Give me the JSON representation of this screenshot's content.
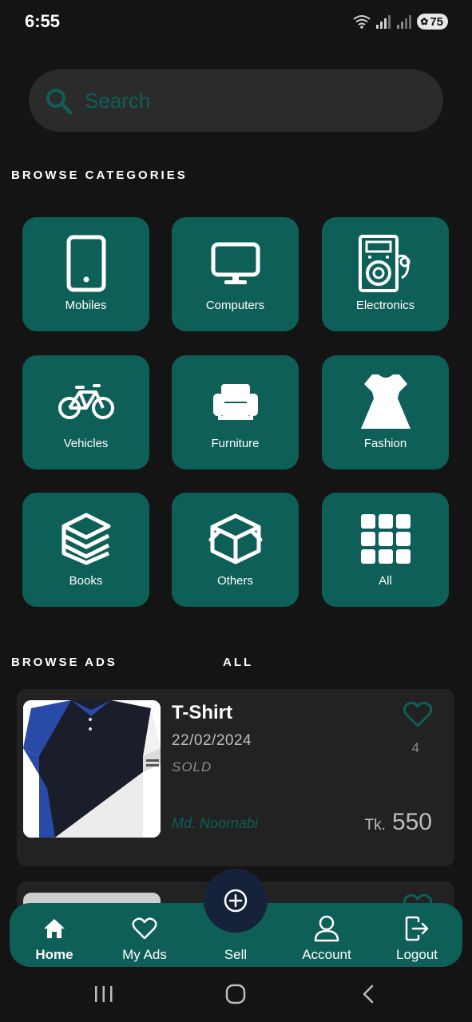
{
  "status_bar": {
    "time": "6:55",
    "battery": "75"
  },
  "search": {
    "placeholder": "Search"
  },
  "categories": {
    "title": "BROWSE CATEGORIES",
    "items": [
      {
        "label": "Mobiles",
        "icon": "mobile-icon"
      },
      {
        "label": "Computers",
        "icon": "monitor-icon"
      },
      {
        "label": "Electronics",
        "icon": "speaker-icon"
      },
      {
        "label": "Vehicles",
        "icon": "bicycle-icon"
      },
      {
        "label": "Furniture",
        "icon": "armchair-icon"
      },
      {
        "label": "Fashion",
        "icon": "dress-icon"
      },
      {
        "label": "Books",
        "icon": "books-icon"
      },
      {
        "label": "Others",
        "icon": "box-icon"
      },
      {
        "label": "All",
        "icon": "grid-icon"
      }
    ]
  },
  "ads": {
    "title": "BROWSE ADS",
    "filter": "ALL",
    "items": [
      {
        "title": "T-Shirt",
        "date": "22/02/2024",
        "status": "SOLD",
        "seller": "Md. Noornabi",
        "currency": "Tk.",
        "price": "550",
        "likes": "4"
      }
    ]
  },
  "bottom_nav": {
    "items": [
      {
        "label": "Home",
        "icon": "home-icon"
      },
      {
        "label": "My Ads",
        "icon": "heart-icon"
      },
      {
        "label": "Sell",
        "icon": "plus-circle-icon"
      },
      {
        "label": "Account",
        "icon": "user-icon"
      },
      {
        "label": "Logout",
        "icon": "logout-icon"
      }
    ]
  },
  "colors": {
    "background": "#141414",
    "accent": "#0e5f57",
    "card": "#222222",
    "fab": "#16213a"
  }
}
